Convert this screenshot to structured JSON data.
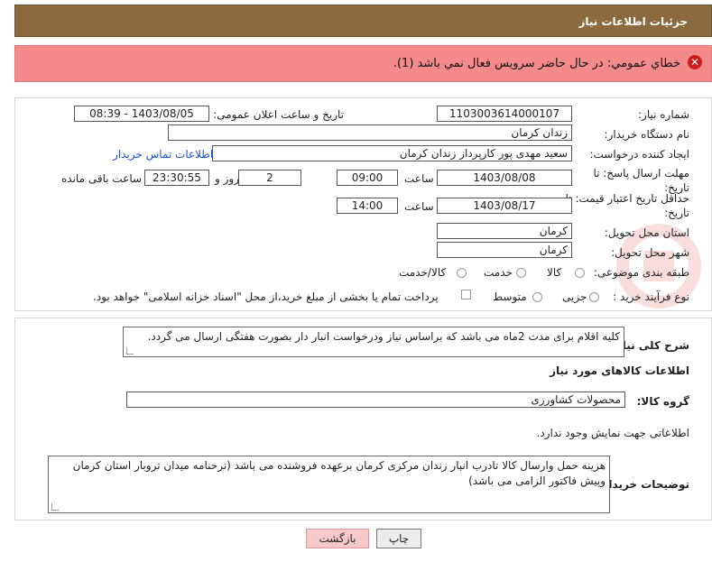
{
  "header": {
    "title": "جزئیات اطلاعات نیاز"
  },
  "error": {
    "icon": "error-circle-icon",
    "text": "خطاي عمومي: در حال حاضر سرويس فعال نمي باشد (1)."
  },
  "form": {
    "need_number_label": "شماره نیاز:",
    "need_number": "1103003614000107",
    "announce_label": "تاریخ و ساعت اعلان عمومی:",
    "announce_value": "1403/08/05 - 08:39",
    "buyer_org_label": "نام دستگاه خریدار:",
    "buyer_org": "زندان کرمان",
    "creator_label": "ایجاد کننده درخواست:",
    "creator": "سعید مهدی پور کارپرداز زندان کرمان",
    "contact_link": "اطلاعات تماس خریدار",
    "deadline_label": "مهلت ارسال پاسخ: تا تاریخ:",
    "deadline_date": "1403/08/08",
    "time_label": "ساعت",
    "deadline_time": "09:00",
    "days_value": "2",
    "days_label": "روز و",
    "remaining_time": "23:30:55",
    "remaining_label": "ساعت باقی مانده",
    "validity_label": "حداقل تاریخ اعتبار قیمت: تا تاریخ:",
    "validity_date": "1403/08/17",
    "validity_time_label": "ساعت",
    "validity_time": "14:00",
    "province_label": "استان محل تحویل:",
    "province": "کرمان",
    "city_label": "شهر محل تحویل:",
    "city": "کرمان",
    "category_label": "طبقه بندی موضوعی:",
    "category_options": [
      "کالا",
      "خدمت",
      "کالا/خدمت"
    ],
    "process_label": "نوع فرآیند خرید :",
    "process_options": [
      "جزیی",
      "متوسط"
    ],
    "payment_text": "پرداخت تمام یا بخشی از مبلغ خرید،از محل \"اسناد خزانه اسلامی\" خواهد بود."
  },
  "description": {
    "general_label": "شرح کلی نیاز:",
    "general_text": "کلیه اقلام برای مدت 2ماه می باشد که براساس نیاز ودرخواست انبار دار بصورت هفتگی ارسال می گردد.",
    "goods_info_title": "اطلاعات کالاهای مورد نیاز",
    "goods_group_label": "گروه کالا:",
    "goods_group": "محصولات کشاورزی",
    "no_info_text": "اطلاعاتی جهت نمایش وجود ندارد.",
    "buyer_notes_label": "توضیحات خریدار:",
    "buyer_notes": "هزینه حمل وارسال کالا تادرب انبار زندان مرکزی کرمان برعهده فروشنده می باشد (نرخنامه میدان تروبار استان کرمان وپیش فاکتور الزامی می باشد)"
  },
  "buttons": {
    "print_label": "چاپ",
    "back_label": "بازگشت"
  },
  "watermark": {
    "text": "AriaTender.net"
  }
}
